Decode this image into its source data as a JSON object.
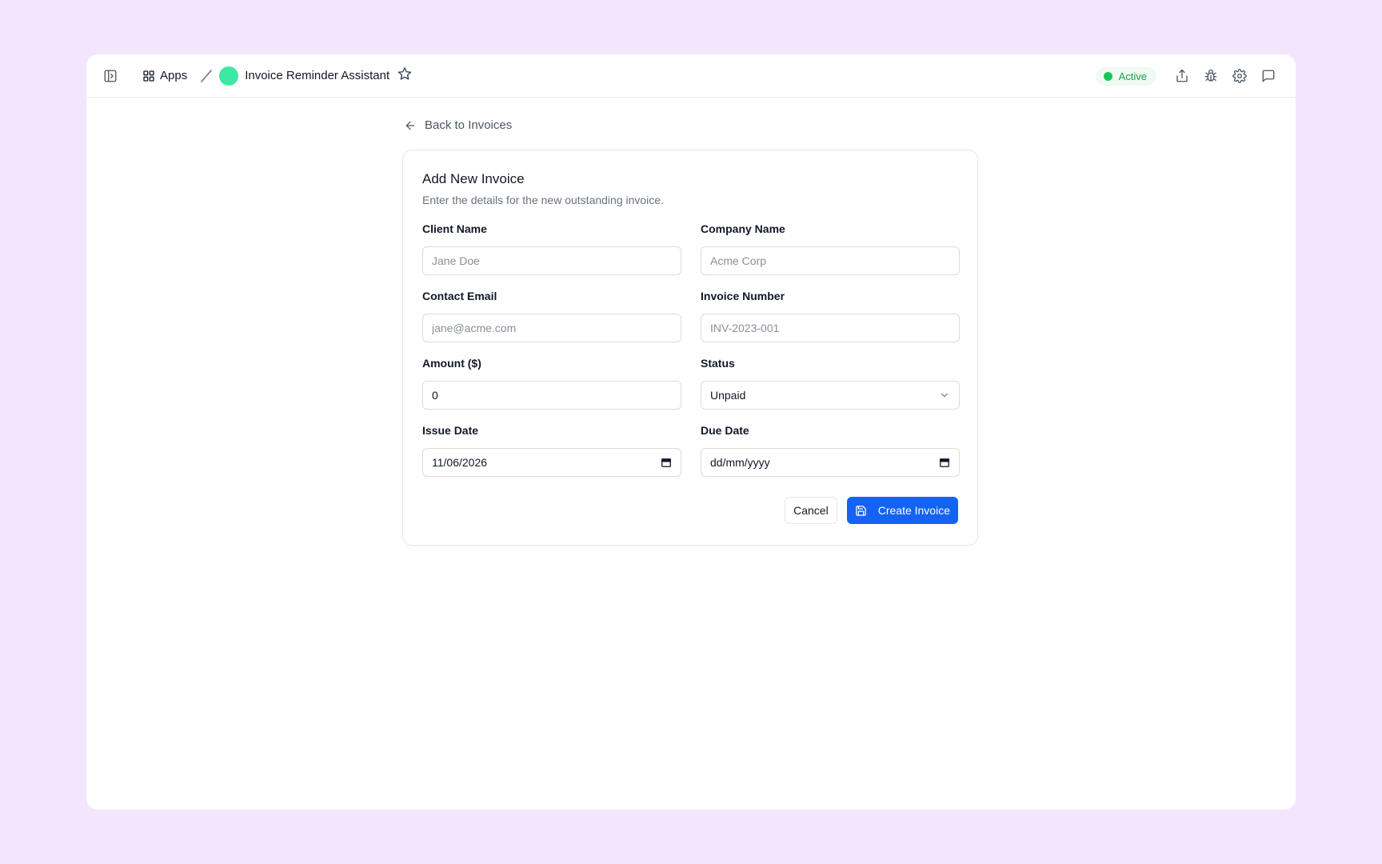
{
  "header": {
    "apps_label": "Apps",
    "app_title": "Invoice Reminder Assistant",
    "status_label": "Active",
    "avatar_color": "#3ee8a3",
    "status_color": "#16a34a",
    "icons": [
      "sidebar-toggle-icon",
      "apps-grid-icon",
      "star-icon",
      "share-icon",
      "bug-icon",
      "gear-icon",
      "chat-icon"
    ]
  },
  "back_link": {
    "label": "Back to Invoices"
  },
  "form": {
    "title": "Add New Invoice",
    "subtitle": "Enter the details for the new outstanding invoice.",
    "client_name": {
      "label": "Client Name",
      "placeholder": "Jane Doe",
      "value": ""
    },
    "company_name": {
      "label": "Company Name",
      "placeholder": "Acme Corp",
      "value": ""
    },
    "contact_email": {
      "label": "Contact Email",
      "placeholder": "jane@acme.com",
      "value": ""
    },
    "invoice_number": {
      "label": "Invoice Number",
      "placeholder": "INV-2023-001",
      "value": ""
    },
    "amount": {
      "label": "Amount ($)",
      "value": "0"
    },
    "status": {
      "label": "Status",
      "selected": "Unpaid"
    },
    "issue_date": {
      "label": "Issue Date",
      "value": "11/06/2026"
    },
    "due_date": {
      "label": "Due Date",
      "value": "dd/mm/yyyy"
    },
    "cancel_label": "Cancel",
    "submit_label": "Create Invoice",
    "accent_color": "#1463f3"
  }
}
